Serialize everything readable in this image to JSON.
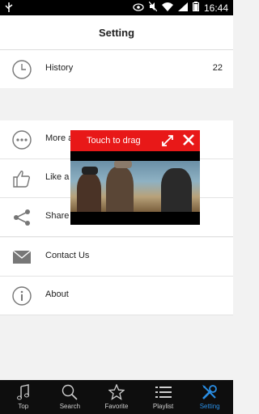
{
  "status": {
    "time": "16:44"
  },
  "header": {
    "title": "Setting"
  },
  "settings": {
    "history": {
      "label": "History",
      "count": "22"
    },
    "more": {
      "label": "More a"
    },
    "like": {
      "label": "Like a"
    },
    "share": {
      "label": "Share"
    },
    "contact": {
      "label": "Contact Us"
    },
    "about": {
      "label": "About"
    }
  },
  "video": {
    "drag_label": "Touch to drag"
  },
  "tabs": [
    {
      "label": "Top",
      "icon": "music-note-icon"
    },
    {
      "label": "Search",
      "icon": "search-icon"
    },
    {
      "label": "Favorite",
      "icon": "star-icon"
    },
    {
      "label": "Playlist",
      "icon": "list-icon"
    },
    {
      "label": "Setting",
      "icon": "tools-icon"
    }
  ],
  "colors": {
    "accent": "#2a8fe6",
    "overlay": "#e81818",
    "tabbar": "#0e0e0e"
  }
}
